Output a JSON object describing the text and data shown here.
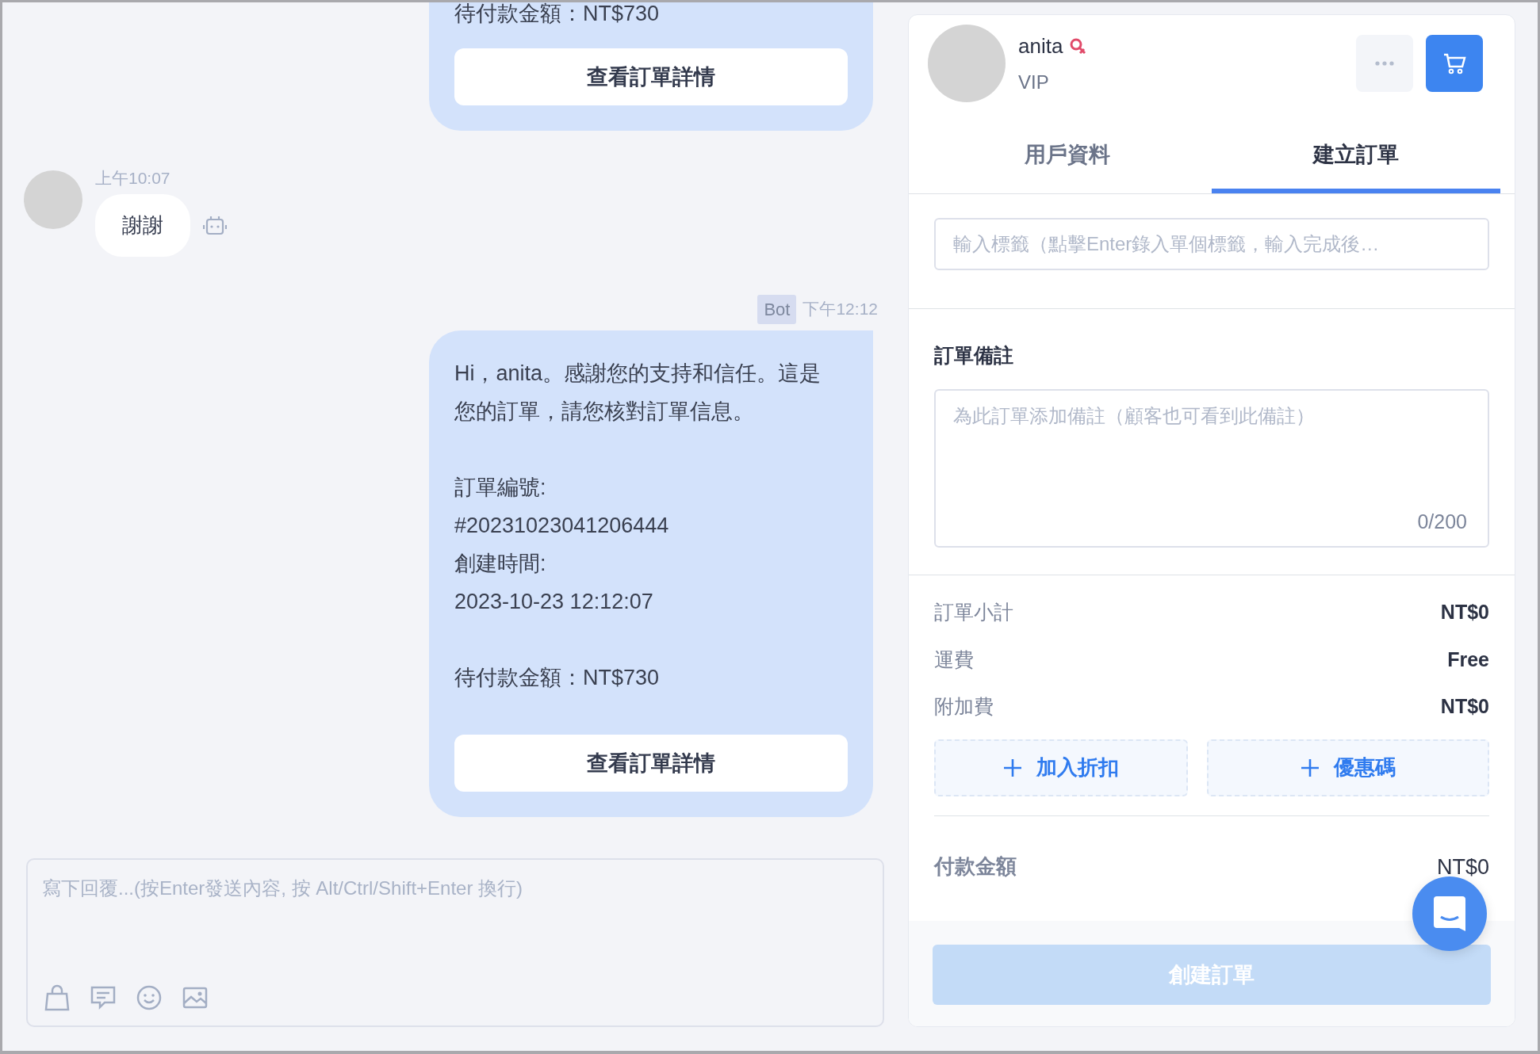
{
  "chat": {
    "messages": [
      {
        "kind": "order_card",
        "lines": [
          [
            "待付款金額：NT$730"
          ]
        ],
        "button": "查看訂單詳情"
      },
      {
        "kind": "text",
        "time": "上午10:07",
        "text": "謝謝"
      },
      {
        "kind": "order_card",
        "tag": "Bot",
        "time": "下午12:12",
        "lines": [
          [
            "Hi，anita。感謝您的支持和信任。這是您的訂單，請您核對訂單信息。"
          ],
          [
            "訂單編號:",
            "#20231023041206444",
            "創建時間:",
            "2023-10-23 12:12:07"
          ],
          [
            "待付款金額：NT$730"
          ]
        ],
        "button": "查看訂單詳情"
      }
    ],
    "composer": {
      "placeholder": "寫下回覆...(按Enter發送內容, 按 Alt/Ctrl/Shift+Enter 換行)"
    }
  },
  "customer": {
    "name": "anita",
    "level": "VIP"
  },
  "tabs": [
    {
      "label": "用戶資料",
      "selected": false
    },
    {
      "label": "建立訂單",
      "selected": true
    }
  ],
  "order": {
    "tags_placeholder": "輸入標籤（點擊Enter錄入單個標籤，輸入完成後…",
    "note_title": "訂單備註",
    "note_placeholder": "為此訂單添加備註（顧客也可看到此備註）",
    "note_counter": "0/200",
    "summary": [
      {
        "label": "訂單小計",
        "value": "NT$0"
      },
      {
        "label": "運費",
        "value": "Free"
      },
      {
        "label": "附加費",
        "value": "NT$0"
      }
    ],
    "actions": [
      "加入折扣",
      "優惠碼"
    ],
    "total_label": "付款金額",
    "total_value": "NT$0",
    "create_button": {
      "label": "創建訂單",
      "disabled": true
    }
  }
}
